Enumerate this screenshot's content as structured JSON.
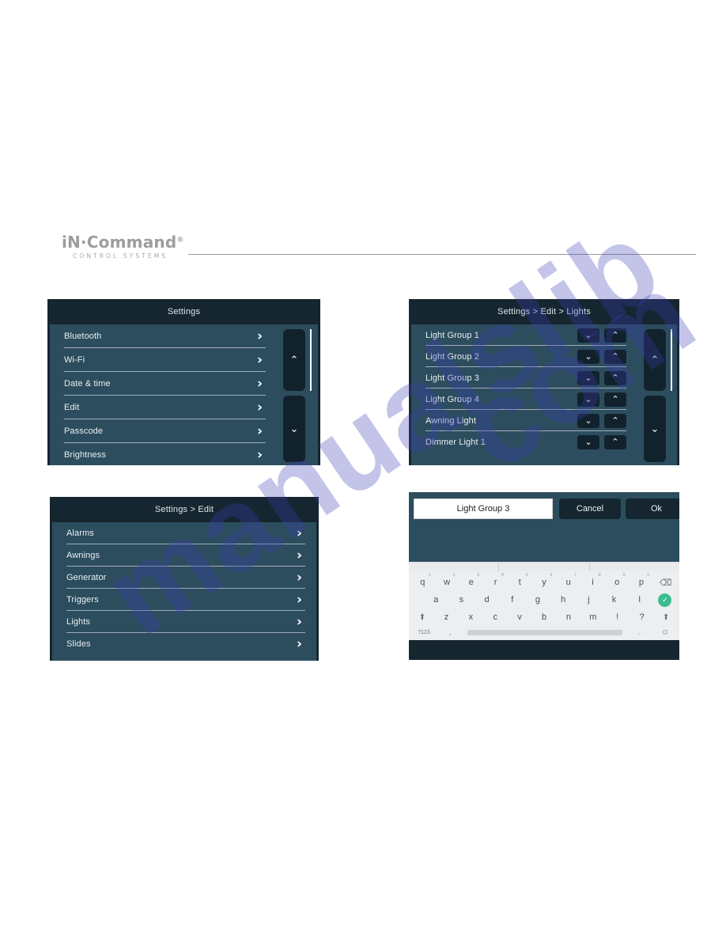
{
  "brand": {
    "logo_main": "iN·Command",
    "logo_registered": "®",
    "logo_sub": "CONTROL SYSTEMS"
  },
  "watermark": {
    "text_a": "manualslib",
    "text_b": "com"
  },
  "panels": {
    "settings": {
      "title": "Settings",
      "items": [
        {
          "label": "Bluetooth",
          "chevron": "chevron-right-icon"
        },
        {
          "label": "Wi-Fi",
          "chevron": "chevron-right-icon"
        },
        {
          "label": "Date & time",
          "chevron": "chevron-right-icon"
        },
        {
          "label": "Edit",
          "chevron": "chevron-right-icon"
        },
        {
          "label": "Passcode",
          "chevron": "chevron-right-icon"
        },
        {
          "label": "Brightness",
          "chevron": "chevron-right-icon"
        }
      ],
      "scroll_up": "⌃",
      "scroll_down": "⌄"
    },
    "lights": {
      "title": "Settings > Edit > Lights",
      "items": [
        {
          "label": "Light Group 1"
        },
        {
          "label": "Light Group 2"
        },
        {
          "label": "Light Group 3"
        },
        {
          "label": "Light Group 4"
        },
        {
          "label": "Awning Light"
        },
        {
          "label": "Dimmer Light 1"
        }
      ],
      "move_down": "⌄",
      "move_up": "⌃",
      "scroll_up": "⌃",
      "scroll_down": "⌄"
    },
    "edit": {
      "title": "Settings > Edit",
      "items": [
        {
          "label": "Alarms",
          "chevron": "chevron-right-icon"
        },
        {
          "label": "Awnings",
          "chevron": "chevron-right-icon"
        },
        {
          "label": "Generator",
          "chevron": "chevron-right-icon"
        },
        {
          "label": "Triggers",
          "chevron": "chevron-right-icon"
        },
        {
          "label": "Lights",
          "chevron": "chevron-right-icon"
        },
        {
          "label": "Slides",
          "chevron": "chevron-right-icon"
        }
      ]
    },
    "rename": {
      "input_value": "Light Group 3",
      "input_placeholder": "",
      "cancel_label": "Cancel",
      "ok_label": "Ok",
      "keyboard": {
        "row1": [
          {
            "key": "q",
            "sup": "1"
          },
          {
            "key": "w",
            "sup": "2"
          },
          {
            "key": "e",
            "sup": "3"
          },
          {
            "key": "r",
            "sup": "4"
          },
          {
            "key": "t",
            "sup": "5"
          },
          {
            "key": "y",
            "sup": "6"
          },
          {
            "key": "u",
            "sup": "7"
          },
          {
            "key": "i",
            "sup": "8"
          },
          {
            "key": "o",
            "sup": "9"
          },
          {
            "key": "p",
            "sup": "0"
          }
        ],
        "backspace": "⌫",
        "row2": [
          "a",
          "s",
          "d",
          "f",
          "g",
          "h",
          "j",
          "k",
          "l"
        ],
        "enter": "✓",
        "row3": [
          "z",
          "x",
          "c",
          "v",
          "b",
          "n",
          "m",
          "!",
          "?"
        ],
        "shift_left": "⬆",
        "shift_right": "⬆",
        "num_key": "?123",
        "comma": ",",
        "period": ".",
        "emoji": "☺",
        "space": ""
      }
    }
  }
}
